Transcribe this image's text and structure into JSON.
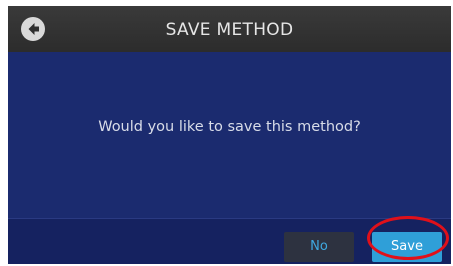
{
  "header": {
    "title": "SAVE METHOD",
    "back_icon": "back-arrow-icon"
  },
  "dialog": {
    "message": "Would you like to save this method?"
  },
  "footer": {
    "no_label": "No",
    "save_label": "Save"
  },
  "colors": {
    "background": "#1b2b6f",
    "header": "#2f2f2f",
    "accent": "#2f9fd8",
    "highlight": "#e0101a"
  }
}
